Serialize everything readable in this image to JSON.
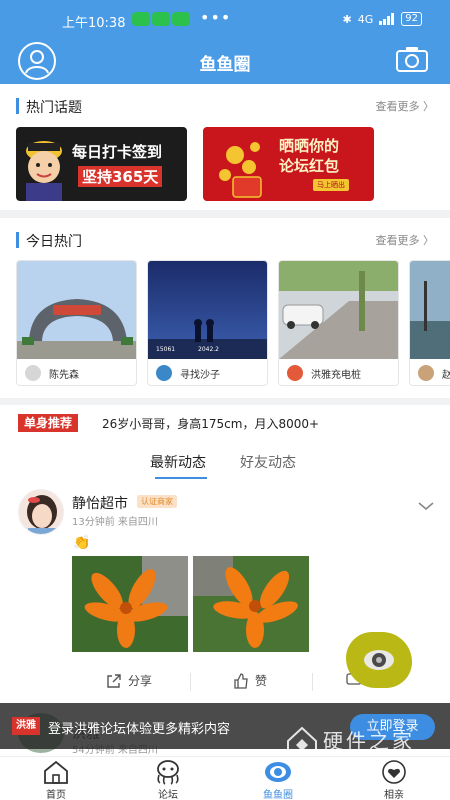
{
  "status_bar": {
    "time": "上午10:38",
    "dots": "•••",
    "network": "4G",
    "battery": "92"
  },
  "app_bar": {
    "title": "鱼鱼圈"
  },
  "hot_topics": {
    "title": "热门话题",
    "more": "查看更多",
    "banners": [
      {
        "line1": "每日打卡签到",
        "line2": "坚持365天"
      },
      {
        "line1": "晒晒你的",
        "line2": "论坛红包",
        "button": "马上晒出"
      }
    ]
  },
  "today_hot": {
    "title": "今日热门",
    "more": "查看更多",
    "cards": [
      {
        "name": "陈先森"
      },
      {
        "name": "寻找沙子",
        "overlay1": "15061",
        "overlay2": "2042.2"
      },
      {
        "name": "洪雅充电桩"
      },
      {
        "name": "赵"
      }
    ]
  },
  "single": {
    "tag": "单身推荐",
    "text": "26岁小哥哥，身高175cm，月入8000+"
  },
  "feed_tabs": {
    "latest": "最新动态",
    "friends": "好友动态"
  },
  "post": {
    "name": "静怡超市",
    "badge": "认证商家",
    "meta": "13分钟前  来自四川",
    "emoji": "👏",
    "share": "分享",
    "like": "赞"
  },
  "login_bar": {
    "logo": "洪雅",
    "text": "登录洪雅论坛体验更多精彩内容",
    "button": "立即登录"
  },
  "next_post_peek": {
    "name": "洪雅",
    "meta": "54分钟前  来自四川"
  },
  "tabbar": [
    {
      "label": "首页",
      "active": false
    },
    {
      "label": "论坛",
      "active": false
    },
    {
      "label": "鱼鱼圈",
      "active": true
    },
    {
      "label": "相亲",
      "active": false
    }
  ],
  "watermark": {
    "big": "硬件之家",
    "small": "YING JIAN ZHI JIA.COM"
  },
  "colors": {
    "primary": "#4a9be6",
    "accent": "#3f8ee0",
    "red": "#d9342b",
    "active_tab": "#3d8ee2"
  }
}
